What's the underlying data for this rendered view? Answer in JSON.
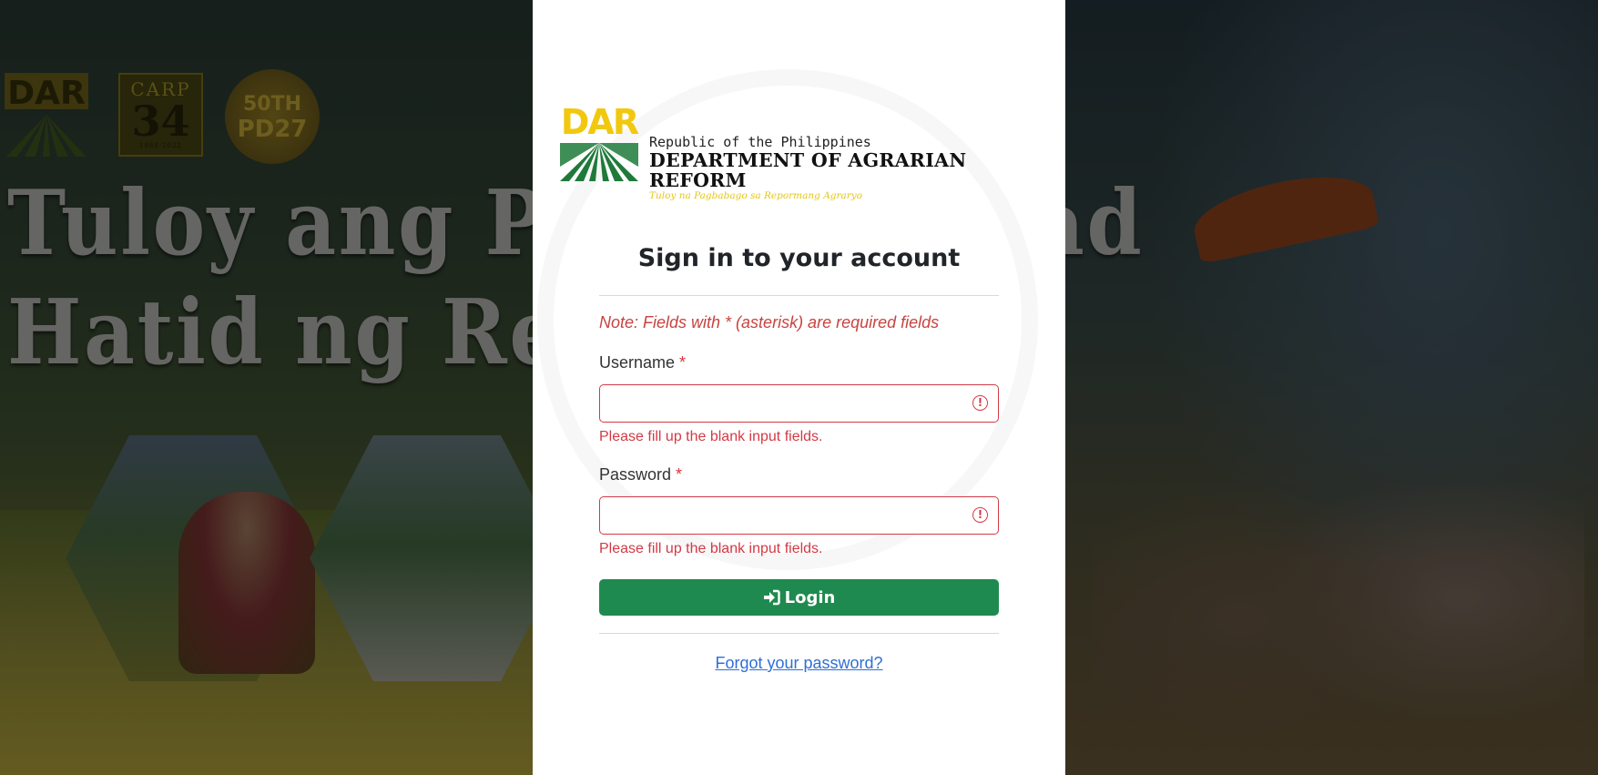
{
  "background": {
    "headline_line1": "Tuloy ang Pag-",
    "headline_line2": "Hatid ng Repor",
    "headline_right": "ad",
    "carp_logo": {
      "top": "CARP",
      "number": "34",
      "years": "1988-2022"
    },
    "anniversary_logo": {
      "line1": "50TH",
      "line2": "PD27"
    },
    "dar_logo_text": "DAR"
  },
  "brand": {
    "logo_text": "DAR",
    "republic": "Republic of the Philippines",
    "department": "DEPARTMENT OF AGRARIAN REFORM",
    "tagline": "Tuloy na Pagbabago sa Repormang Agraryo"
  },
  "form": {
    "title": "Sign in to your account",
    "note": "Note: Fields with * (asterisk) are required fields",
    "username": {
      "label": "Username",
      "required_mark": "*",
      "value": "",
      "error": "Please fill up the blank input fields."
    },
    "password": {
      "label": "Password",
      "required_mark": "*",
      "value": "",
      "error": "Please fill up the blank input fields."
    },
    "login_label": "Login",
    "forgot_label": "Forgot your password?"
  },
  "colors": {
    "primary": "#1f8a4f",
    "error": "#d33a46",
    "link": "#2f6fd6",
    "brand_yellow": "#f2c80f",
    "brand_green": "#1f7a3a"
  }
}
